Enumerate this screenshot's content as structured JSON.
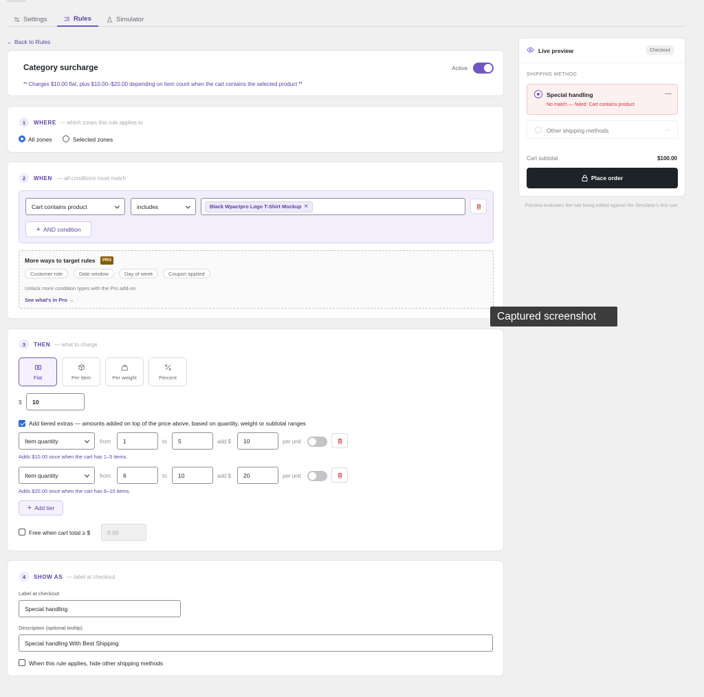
{
  "tabs": [
    {
      "label": "Settings",
      "icon": "sliders-icon"
    },
    {
      "label": "Rules",
      "icon": "list-check-icon"
    },
    {
      "label": "Simulator",
      "icon": "flask-icon"
    }
  ],
  "back_link": "← Back to Rules",
  "header": {
    "title": "Category surcharge",
    "active_label": "Active",
    "summary": "❛❛ Charges $10.00 flat, plus $10.00–$20.00 depending on item count when the cart contains the selected product ❜❜"
  },
  "where": {
    "num": "1",
    "title": "WHERE",
    "sub": "— which zones this rule applies to",
    "options": [
      "All zones",
      "Selected zones"
    ]
  },
  "when": {
    "num": "2",
    "title": "WHEN",
    "sub": "— all conditions must match",
    "condition_type": "Cart contains product",
    "operator": "includes",
    "product_tag": "Black Wpactpro Logo T-Shirt Mockup",
    "tag_remove": "×",
    "and_button": "AND condition",
    "more_title": "More ways to target rules",
    "pro_badge": "PRO",
    "pills": [
      "Customer role",
      "Date window",
      "Day of week",
      "Coupon applied"
    ],
    "more_note": "Unlock more condition types with the Pro add-on.",
    "more_link": "See what's in Pro →"
  },
  "then": {
    "num": "3",
    "title": "THEN",
    "sub": "— what to charge",
    "types": [
      {
        "label": "Flat",
        "icon": "money-icon"
      },
      {
        "label": "Per item",
        "icon": "box-icon"
      },
      {
        "label": "Per weight",
        "icon": "weight-icon"
      },
      {
        "label": "Percent",
        "icon": "percent-icon"
      }
    ],
    "currency": "$",
    "amount": "10",
    "tiered_label": "Add tiered extras — amounts added on top of the price above, based on quantity, weight or subtotal ranges",
    "tiers": [
      {
        "basis": "Item quantity",
        "from_label": "from",
        "from": "1",
        "to_label": "to",
        "to": "5",
        "add_label": "add $",
        "add": "10",
        "per_unit_label": "per unit",
        "note": "Adds $10.00 once when the cart has 1–5 items."
      },
      {
        "basis": "Item quantity",
        "from_label": "from",
        "from": "6",
        "to_label": "to",
        "to": "10",
        "add_label": "add $",
        "add": "20",
        "per_unit_label": "per unit",
        "note": "Adds $20.00 once when the cart has 6–10 items."
      }
    ],
    "add_tier": "Add tier",
    "free_label": "Free when cart total ≥ $",
    "free_placeholder": "0.00"
  },
  "show_as": {
    "num": "4",
    "title": "SHOW AS",
    "sub": "— label at checkout",
    "label_title": "Label at checkout",
    "label_value": "Special handling",
    "desc_title": "Description (optional tooltip)",
    "desc_value": "Special handling With Best Shipping",
    "hide_label": "When this rule applies, hide other shipping methods"
  },
  "preview": {
    "title": "Live preview",
    "badge": "Checkout",
    "section": "SHIPPING METHOD",
    "option1_name": "Special handling",
    "option1_dash": "—",
    "option1_error": "No match — failed: Cart contains product",
    "option2_name": "Other shipping methods",
    "option2_dots": "...",
    "subtotal_label": "Cart subtotal",
    "subtotal_value": "$100.00",
    "place_order": "Place order",
    "note": "Preview evaluates the rule being edited against the Simulator's test cart."
  },
  "tooltip": "Captured screenshot",
  "colors": {
    "accent": "#7256c4",
    "accent_text": "#5b3fa6",
    "error": "#d63638",
    "dark": "#1d2327"
  }
}
